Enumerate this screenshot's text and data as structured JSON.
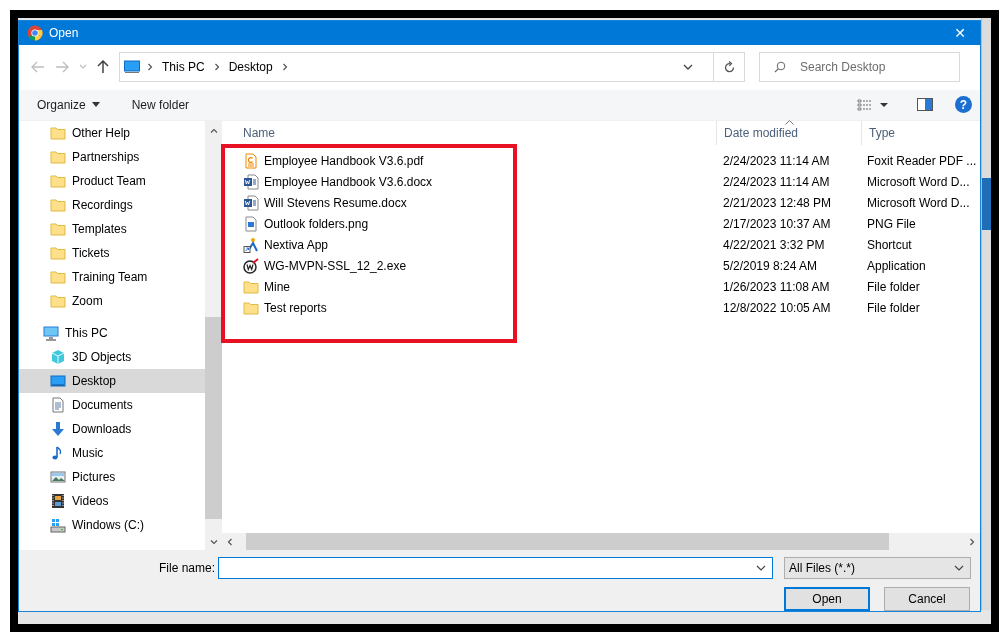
{
  "window": {
    "title": "Open",
    "close": "✕"
  },
  "address": {
    "crumbs": [
      "This PC",
      "Desktop"
    ]
  },
  "search": {
    "placeholder": "Search Desktop"
  },
  "toolbar": {
    "buttons": [
      {
        "label": "Organize",
        "kind": "menu"
      },
      {
        "label": "New folder",
        "kind": "plain"
      }
    ],
    "help": "?"
  },
  "nav": {
    "quick_access_children": [
      {
        "label": "Other Help",
        "kind": "folder",
        "selected": false
      },
      {
        "label": "Partnerships",
        "kind": "folder",
        "selected": false
      },
      {
        "label": "Product Team",
        "kind": "folder",
        "selected": false
      },
      {
        "label": "Recordings",
        "kind": "folder",
        "selected": false
      },
      {
        "label": "Templates",
        "kind": "folder",
        "selected": false
      },
      {
        "label": "Tickets",
        "kind": "folder",
        "selected": false
      },
      {
        "label": "Training Team",
        "kind": "folder",
        "selected": false
      },
      {
        "label": "Zoom",
        "kind": "folder",
        "selected": false
      }
    ],
    "this_pc": {
      "label": "This PC",
      "kind": "pc",
      "selected": false,
      "children": [
        {
          "label": "3D Objects",
          "kind": "cube",
          "selected": false
        },
        {
          "label": "Desktop",
          "kind": "desktop",
          "selected": true
        },
        {
          "label": "Documents",
          "kind": "documents",
          "selected": false
        },
        {
          "label": "Downloads",
          "kind": "downloads",
          "selected": false
        },
        {
          "label": "Music",
          "kind": "music",
          "selected": false
        },
        {
          "label": "Pictures",
          "kind": "pictures",
          "selected": false
        },
        {
          "label": "Videos",
          "kind": "videos",
          "selected": false
        },
        {
          "label": "Windows (C:)",
          "kind": "drive",
          "selected": false
        }
      ]
    }
  },
  "table": {
    "columns": [
      {
        "label": "Name",
        "sorted": false
      },
      {
        "label": "Date modified",
        "sorted": true
      },
      {
        "label": "Type",
        "sorted": false
      }
    ],
    "rows": [
      {
        "name": "Employee Handbook V3.6.pdf",
        "date": "2/24/2023 11:14 AM",
        "type": "Foxit Reader PDF ...",
        "kind": "pdf"
      },
      {
        "name": "Employee Handbook V3.6.docx",
        "date": "2/24/2023 11:14 AM",
        "type": "Microsoft Word D...",
        "kind": "word"
      },
      {
        "name": "Will Stevens Resume.docx",
        "date": "2/21/2023 12:48 PM",
        "type": "Microsoft Word D...",
        "kind": "word"
      },
      {
        "name": "Outlook folders.png",
        "date": "2/17/2023 10:37 AM",
        "type": "PNG File",
        "kind": "image"
      },
      {
        "name": "Nextiva App",
        "date": "4/22/2021 3:32 PM",
        "type": "Shortcut",
        "kind": "shortcut"
      },
      {
        "name": "WG-MVPN-SSL_12_2.exe",
        "date": "5/2/2019 8:24 AM",
        "type": "Application",
        "kind": "exe"
      },
      {
        "name": "Mine",
        "date": "1/26/2023 11:08 AM",
        "type": "File folder",
        "kind": "folder"
      },
      {
        "name": "Test reports",
        "date": "12/8/2022 10:05 AM",
        "type": "File folder",
        "kind": "folder"
      }
    ]
  },
  "annotation": {
    "kind": "rectangle"
  },
  "footer": {
    "file_name_label": "File name:",
    "filter": "All Files (*.*)",
    "buttons": [
      {
        "label": "Open",
        "default": true
      },
      {
        "label": "Cancel",
        "default": false
      }
    ]
  }
}
